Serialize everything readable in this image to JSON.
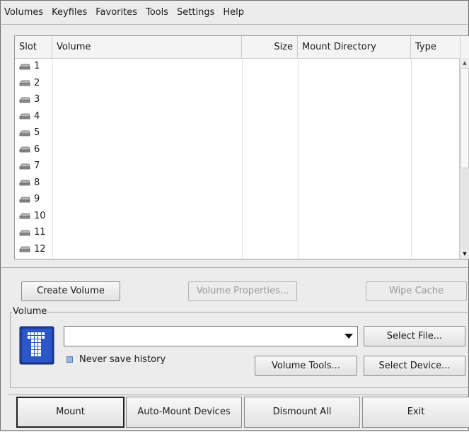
{
  "menu": [
    "Volumes",
    "Keyfiles",
    "Favorites",
    "Tools",
    "Settings",
    "Help"
  ],
  "table": {
    "headers": {
      "slot": "Slot",
      "volume": "Volume",
      "size": "Size",
      "mount": "Mount Directory",
      "type": "Type"
    },
    "rows": [
      "1",
      "2",
      "3",
      "4",
      "5",
      "6",
      "7",
      "8",
      "9",
      "10",
      "11",
      "12"
    ]
  },
  "buttons": {
    "create_volume": "Create Volume",
    "volume_properties": "Volume Properties...",
    "wipe_cache": "Wipe Cache"
  },
  "volume_group": {
    "legend": "Volume",
    "path_value": "",
    "never_save_history": "Never save history",
    "select_file": "Select File...",
    "volume_tools": "Volume Tools...",
    "select_device": "Select Device..."
  },
  "bottom": {
    "mount": "Mount",
    "auto_mount": "Auto-Mount Devices",
    "dismount_all": "Dismount All",
    "exit": "Exit"
  }
}
